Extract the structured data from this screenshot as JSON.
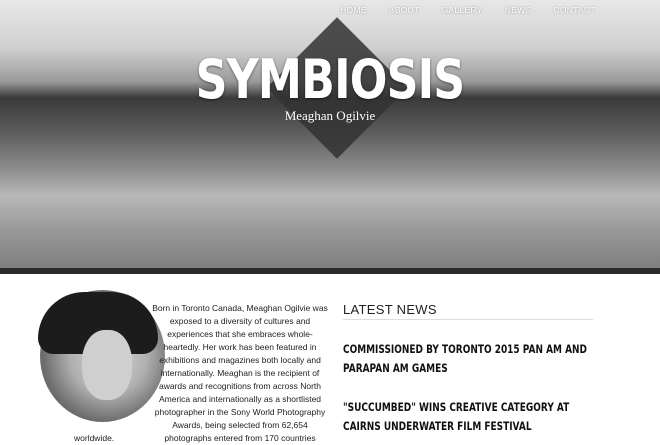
{
  "nav": {
    "items": [
      "HOME",
      "ABOUT",
      "GALLERY",
      "NEWS",
      "CONTACT"
    ]
  },
  "hero": {
    "title": "SYMBIOSIS",
    "subtitle": "Meaghan Ogilvie"
  },
  "bio": {
    "text": "Born in Toronto Canada, Meaghan Ogilvie was exposed to a diversity of cultures and experiences that she embraces whole-heartedly. Her work has been featured in exhibitions and magazines both locally and internationally. Meaghan is the recipient of awards and recognitions from across North America and internationally as a shortlisted photographer in the Sony World Photography Awards, being selected from 62,654 photographs entered from 170 countries",
    "tail": "worldwide."
  },
  "news": {
    "heading": "LATEST NEWS",
    "items": [
      "Commissioned by Toronto 2015 Pan Am and Parapan Am Games",
      "\"Succumbed\" wins Creative Category at Cairns Underwater Film Festival"
    ]
  },
  "colors": {
    "hero_border": "#2b2b2b",
    "diamond": "#323232",
    "text": "#222222"
  }
}
